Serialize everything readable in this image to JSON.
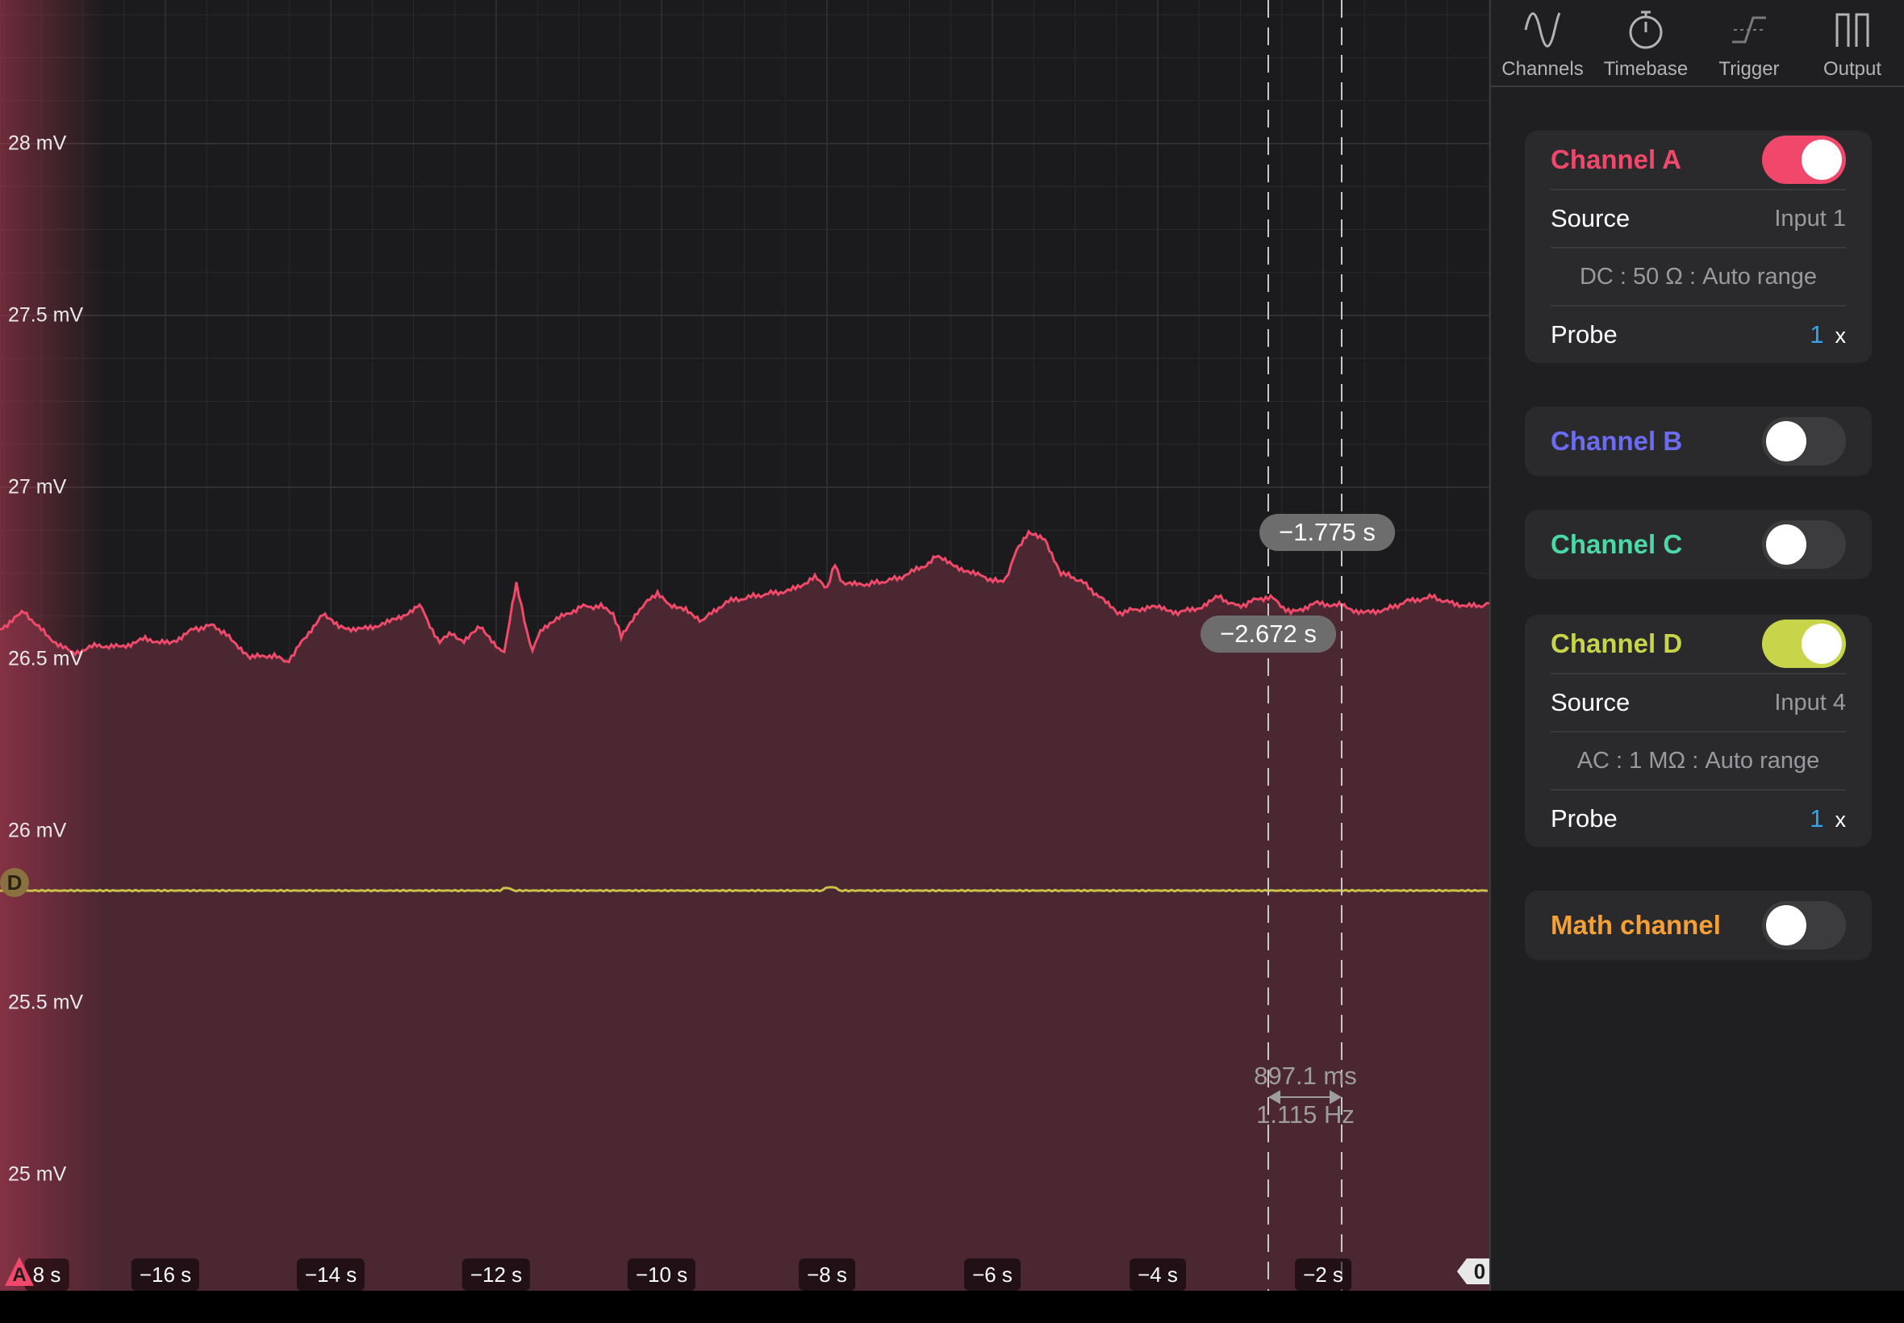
{
  "scope": {
    "y_axis_labels": [
      "28 mV",
      "27.5 mV",
      "27 mV",
      "26.5 mV",
      "26 mV",
      "25.5 mV",
      "25 mV"
    ],
    "x_axis_labels": [
      "-18 s",
      "−16 s",
      "−14 s",
      "−12 s",
      "−10 s",
      "−8 s",
      "−6 s",
      "−4 s",
      "−2 s"
    ],
    "x_axis_first_visible": "8 s",
    "cursor1_value": "−2.672 s",
    "cursor2_value": "−1.775 s",
    "delta_time": "897.1 ms",
    "delta_freq": "1.115 Hz",
    "channel_a_marker": "A",
    "channel_d_marker": "D",
    "trigger_marker": "0",
    "trace_colors": {
      "channel_a": "#ef4a6a",
      "channel_d": "#c9c04a"
    }
  },
  "tabs": [
    {
      "label": "Channels",
      "icon": "sine-wave-icon"
    },
    {
      "label": "Timebase",
      "icon": "stopwatch-icon"
    },
    {
      "label": "Trigger",
      "icon": "trigger-edge-icon"
    },
    {
      "label": "Output",
      "icon": "square-wave-icon"
    }
  ],
  "channels": {
    "a": {
      "title": "Channel A",
      "color": "#f0476b",
      "enabled": true,
      "source_label": "Source",
      "source_value": "Input 1",
      "coupling": "DC : 50 Ω : Auto range",
      "probe_label": "Probe",
      "probe_value": "1",
      "probe_unit": "x"
    },
    "b": {
      "title": "Channel B",
      "color": "#6c6cf2",
      "enabled": false
    },
    "c": {
      "title": "Channel C",
      "color": "#4bd7a6",
      "enabled": false
    },
    "d": {
      "title": "Channel D",
      "color": "#c8d54a",
      "enabled": true,
      "source_label": "Source",
      "source_value": "Input 4",
      "coupling": "AC : 1 MΩ : Auto range",
      "probe_label": "Probe",
      "probe_value": "1",
      "probe_unit": "x"
    },
    "math": {
      "title": "Math channel",
      "color": "#f5a036",
      "enabled": false
    }
  }
}
